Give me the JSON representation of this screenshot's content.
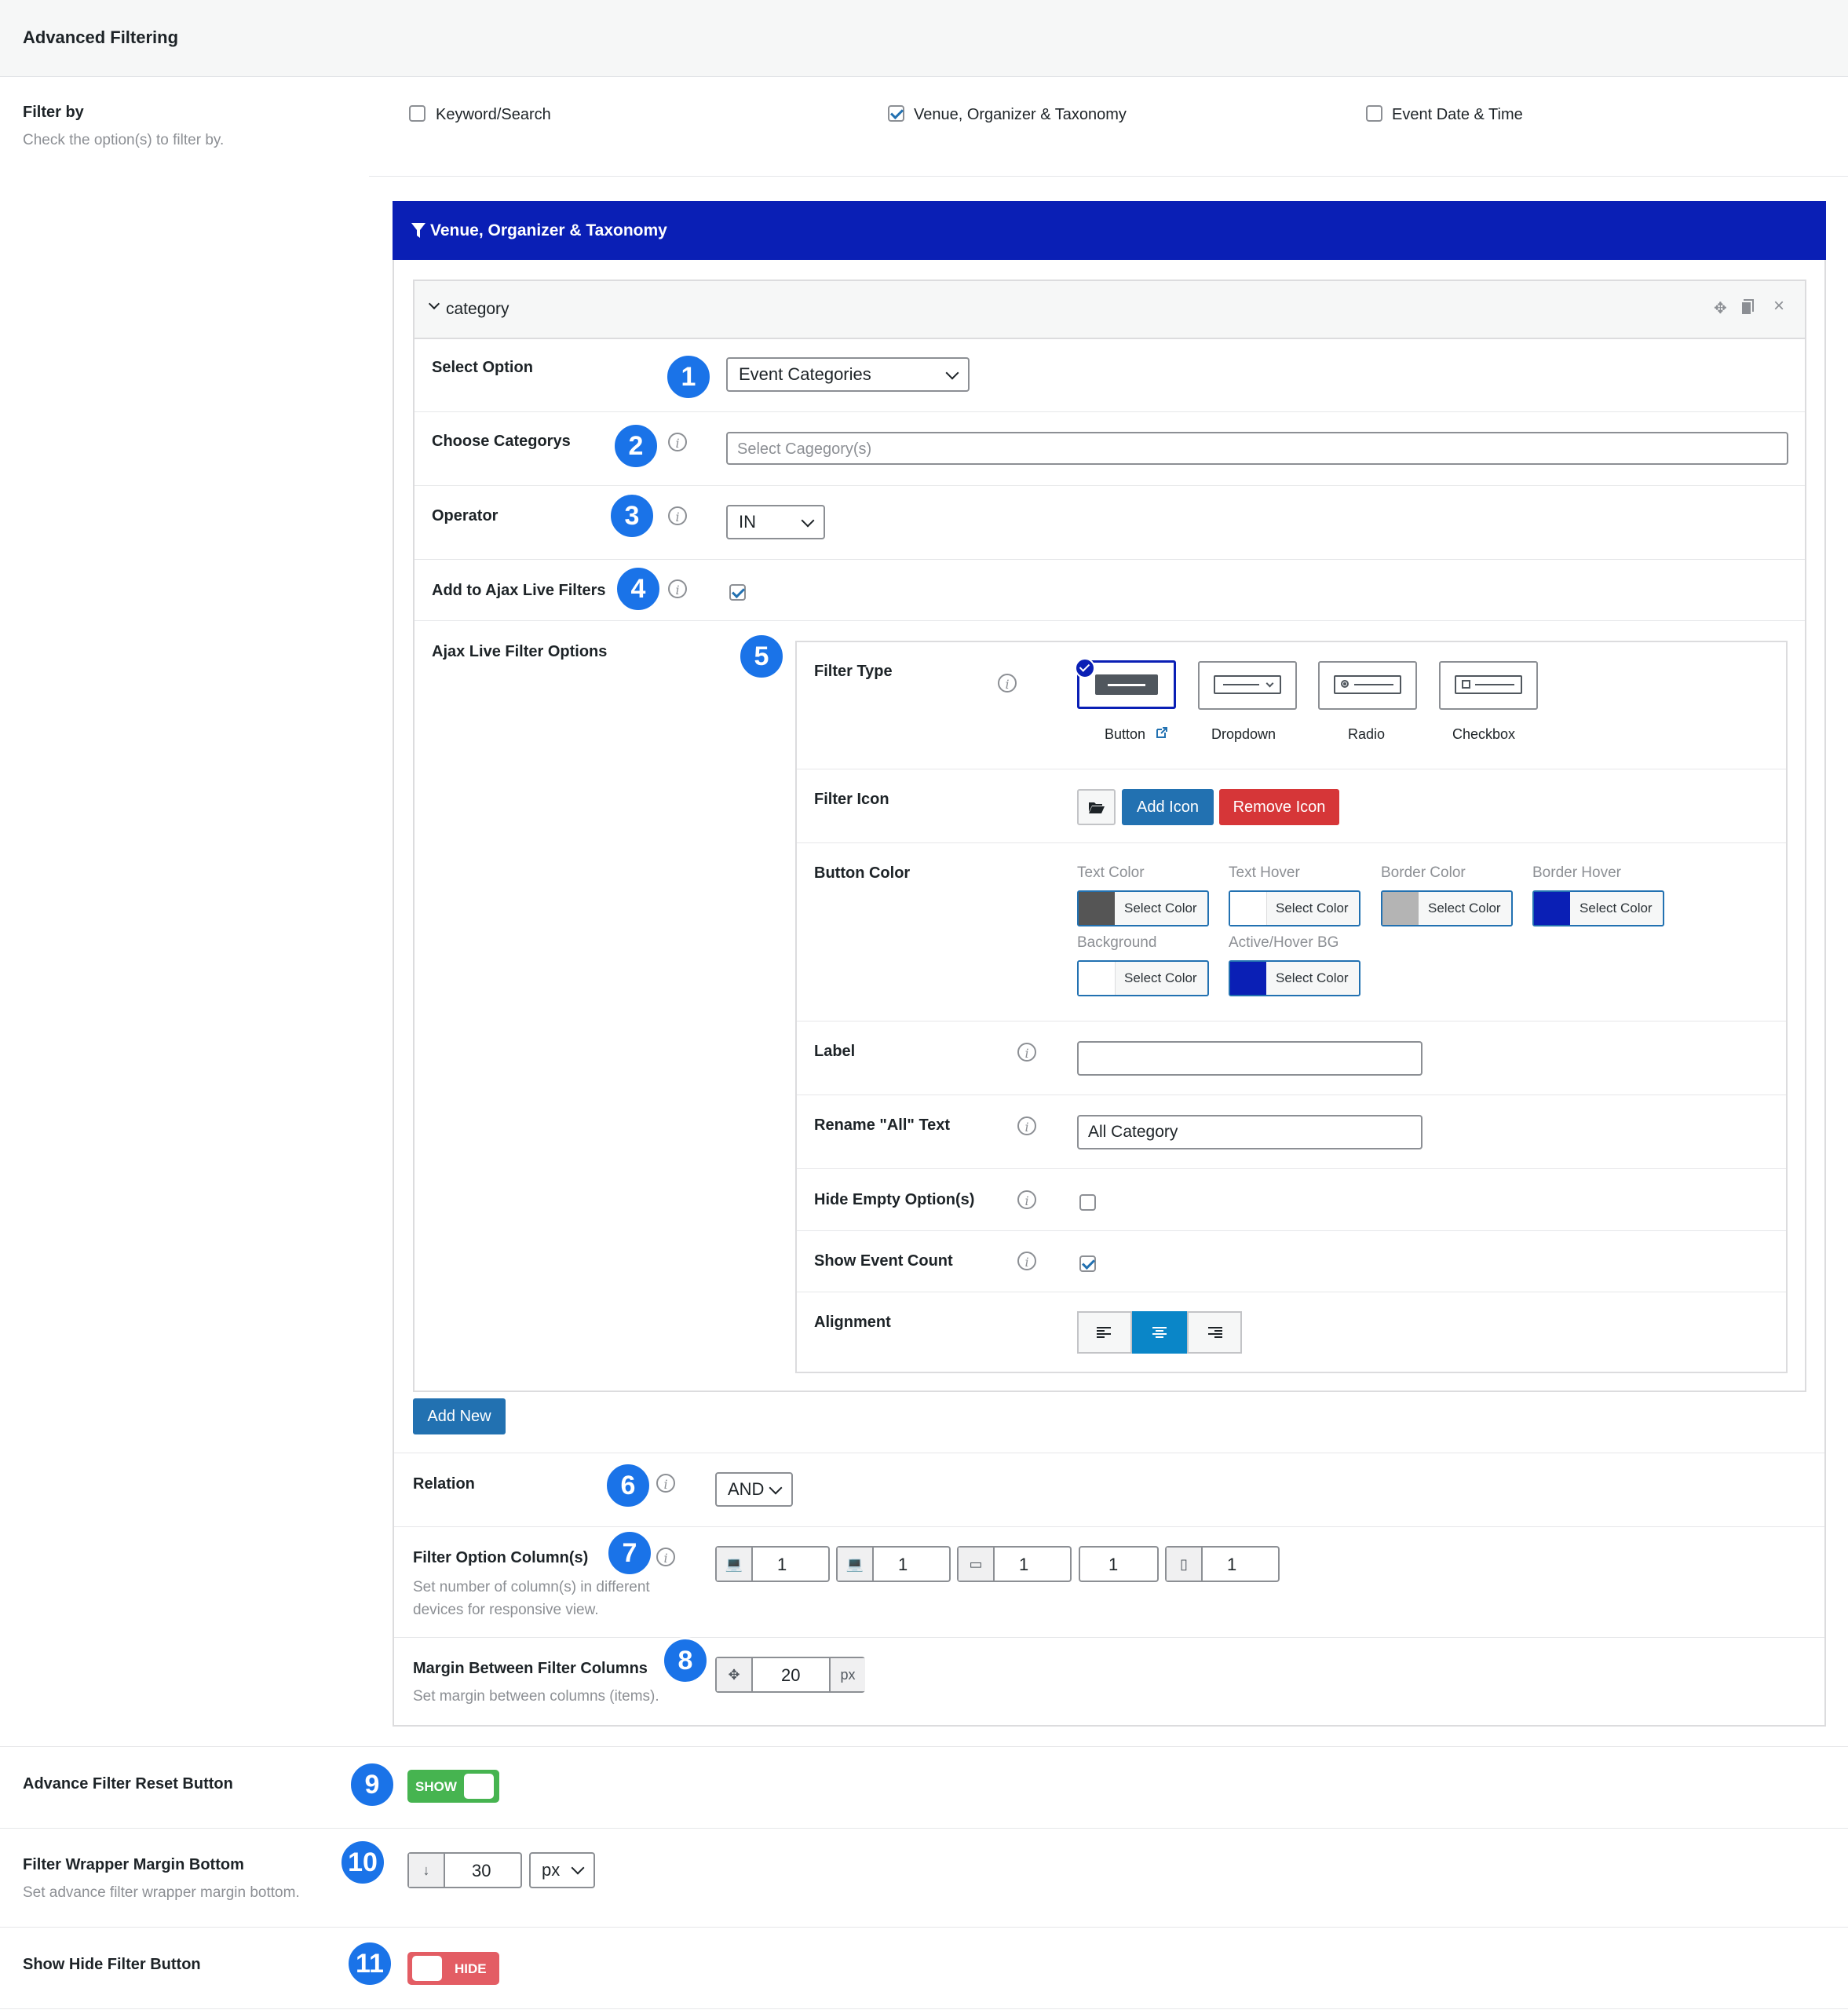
{
  "header": {
    "title": "Advanced Filtering"
  },
  "filter_by": {
    "label": "Filter by",
    "description": "Check the option(s) to filter by.",
    "options": [
      {
        "label": "Keyword/Search",
        "checked": false
      },
      {
        "label": "Venue, Organizer & Taxonomy",
        "checked": true
      },
      {
        "label": "Event Date & Time",
        "checked": false
      }
    ]
  },
  "panel": {
    "title": "Venue, Organizer & Taxonomy",
    "accent": "#0a1fb5",
    "item": {
      "title": "category",
      "select_option": {
        "label": "Select Option",
        "value": "Event Categories"
      },
      "choose_categories": {
        "label": "Choose Categorys",
        "placeholder": "Select Cagegory(s)"
      },
      "operator": {
        "label": "Operator",
        "value": "IN"
      },
      "ajax_live": {
        "label": "Add to Ajax Live Filters",
        "checked": true
      },
      "ajax_options": {
        "label": "Ajax Live Filter Options",
        "filter_type": {
          "label": "Filter Type",
          "selected": "Button",
          "types": [
            "Button",
            "Dropdown",
            "Radio",
            "Checkbox"
          ]
        },
        "filter_icon": {
          "label": "Filter Icon",
          "add": "Add Icon",
          "remove": "Remove Icon"
        },
        "button_color": {
          "label": "Button Color",
          "select_text": "Select Color",
          "colors": [
            {
              "label": "Text Color",
              "color": "#555555"
            },
            {
              "label": "Text Hover",
              "color": "#ffffff"
            },
            {
              "label": "Border Color",
              "color": "#b4b4b4"
            },
            {
              "label": "Border Hover",
              "color": "#0a1fb5"
            },
            {
              "label": "Background",
              "color": "#ffffff"
            },
            {
              "label": "Active/Hover BG",
              "color": "#0a1fb5"
            }
          ]
        },
        "label_field": {
          "label": "Label",
          "value": ""
        },
        "rename_all": {
          "label": "Rename \"All\" Text",
          "value": "All Category"
        },
        "hide_empty": {
          "label": "Hide Empty Option(s)",
          "checked": false
        },
        "show_count": {
          "label": "Show Event Count",
          "checked": true
        },
        "alignment": {
          "label": "Alignment",
          "selected": "center"
        }
      }
    },
    "add_new": "Add New",
    "relation": {
      "label": "Relation",
      "value": "AND"
    },
    "columns": {
      "label": "Filter Option Column(s)",
      "description": "Set number of column(s) in different devices for responsive view.",
      "values": [
        "1",
        "1",
        "1",
        "1",
        "1"
      ]
    },
    "margin": {
      "label": "Margin Between Filter Columns",
      "description": "Set margin between columns (items).",
      "value": "20",
      "unit": "px"
    }
  },
  "reset_button": {
    "label": "Advance Filter Reset Button",
    "state": "SHOW",
    "on_color": "#46b450"
  },
  "wrapper_margin": {
    "label": "Filter Wrapper Margin Bottom",
    "description": "Set advance filter wrapper margin bottom.",
    "value": "30",
    "unit": "px"
  },
  "show_hide": {
    "label": "Show Hide Filter Button",
    "state": "HIDE",
    "off_color": "#e35d64"
  },
  "badges": [
    "1",
    "2",
    "3",
    "4",
    "5",
    "6",
    "7",
    "8",
    "9",
    "10",
    "11"
  ]
}
